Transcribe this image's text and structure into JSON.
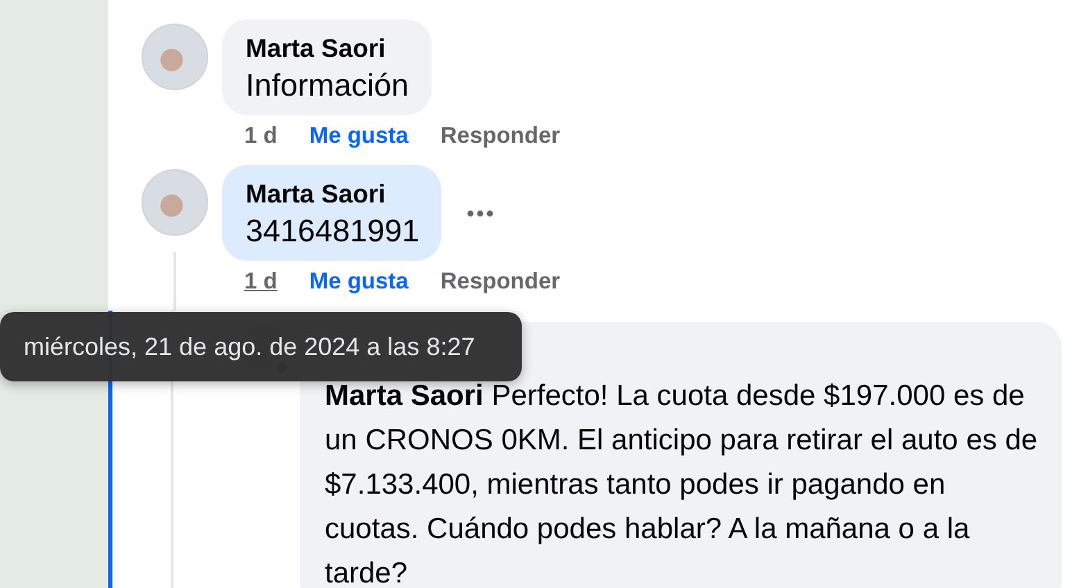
{
  "comments": [
    {
      "author": "Marta Saori",
      "text": "Información",
      "time": "1 d",
      "like": "Me gusta",
      "reply": "Responder",
      "highlighted": false,
      "time_hovered": false
    },
    {
      "author": "Marta Saori",
      "text": "3416481991",
      "time": "1 d",
      "like": "Me gusta",
      "reply": "Responder",
      "highlighted": true,
      "time_hovered": true
    }
  ],
  "reply": {
    "mention": "Marta Saori",
    "text": "Perfecto! La cuota desde $197.000 es de un CRONOS 0KM. El anticipo para retirar el auto es de $7.133.400, mientras tanto podes ir pagando en cuotas. Cuándo podes hablar? A la mañana o a la tarde?",
    "online": true
  },
  "tooltip": {
    "text": "miércoles, 21 de ago. de 2024 a las 8:27"
  }
}
